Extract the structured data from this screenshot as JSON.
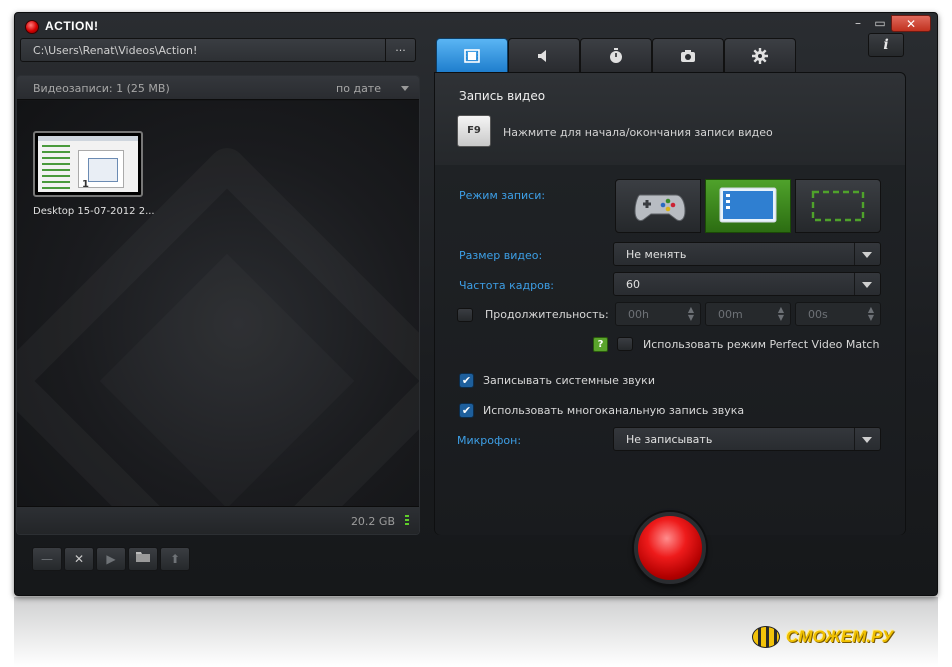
{
  "app": {
    "title": "ACTION!",
    "minimize": "–",
    "maximize": "▭",
    "close": "✕"
  },
  "path": {
    "value": "C:\\Users\\Renat\\Videos\\Action!",
    "browse_label": "..."
  },
  "recordings": {
    "count_label": "Видеозаписи: 1 (25 MB)",
    "sort_label": "по дате",
    "items": [
      {
        "name": "Desktop 15-07-2012 2...",
        "index": "1"
      }
    ],
    "disk_free": "20.2 GB"
  },
  "toolbar": {
    "buttons": [
      {
        "name": "minus",
        "glyph": "—"
      },
      {
        "name": "delete",
        "glyph": "✕"
      },
      {
        "name": "play",
        "glyph": "▶"
      },
      {
        "name": "open-folder",
        "glyph": "📂"
      },
      {
        "name": "upload",
        "glyph": "⬆"
      }
    ]
  },
  "tabs": [
    {
      "name": "video",
      "icon": "film-icon",
      "active": true
    },
    {
      "name": "audio",
      "icon": "speaker-icon",
      "active": false
    },
    {
      "name": "timer",
      "icon": "stopwatch-icon",
      "active": false
    },
    {
      "name": "screenshot",
      "icon": "camera-icon",
      "active": false
    },
    {
      "name": "settings",
      "icon": "gear-icon",
      "active": false
    }
  ],
  "info_label": "i",
  "video": {
    "section_title": "Запись видео",
    "hotkey": "F9",
    "hotkey_hint": "Нажмите для начала/окончания записи видео",
    "mode_label": "Режим записи:",
    "modes": [
      {
        "name": "game",
        "icon": "gamepad-icon",
        "selected": false
      },
      {
        "name": "desktop",
        "icon": "monitor-icon",
        "selected": true
      },
      {
        "name": "region",
        "icon": "region-select-icon",
        "selected": false
      }
    ],
    "size_label": "Размер видео:",
    "size_value": "Не менять",
    "fps_label": "Частота кадров:",
    "fps_value": "60",
    "duration_label": "Продолжительность:",
    "duration": {
      "hours": "00h",
      "minutes": "00m",
      "seconds": "00s"
    },
    "pvm_help": "?",
    "pvm_label": "Использовать режим Perfect Video Match",
    "system_sound_label": "Записывать системные звуки",
    "multichannel_label": "Использовать многоканальную запись звука",
    "mic_label": "Микрофон:",
    "mic_value": "Не записывать"
  },
  "watermark": "СМОЖЕМ.РУ",
  "colors": {
    "accent_blue": "#1f7ecd",
    "label_blue": "#3d9fe6",
    "selected_green": "#4fa22b",
    "record_red": "#ee1b1b"
  }
}
